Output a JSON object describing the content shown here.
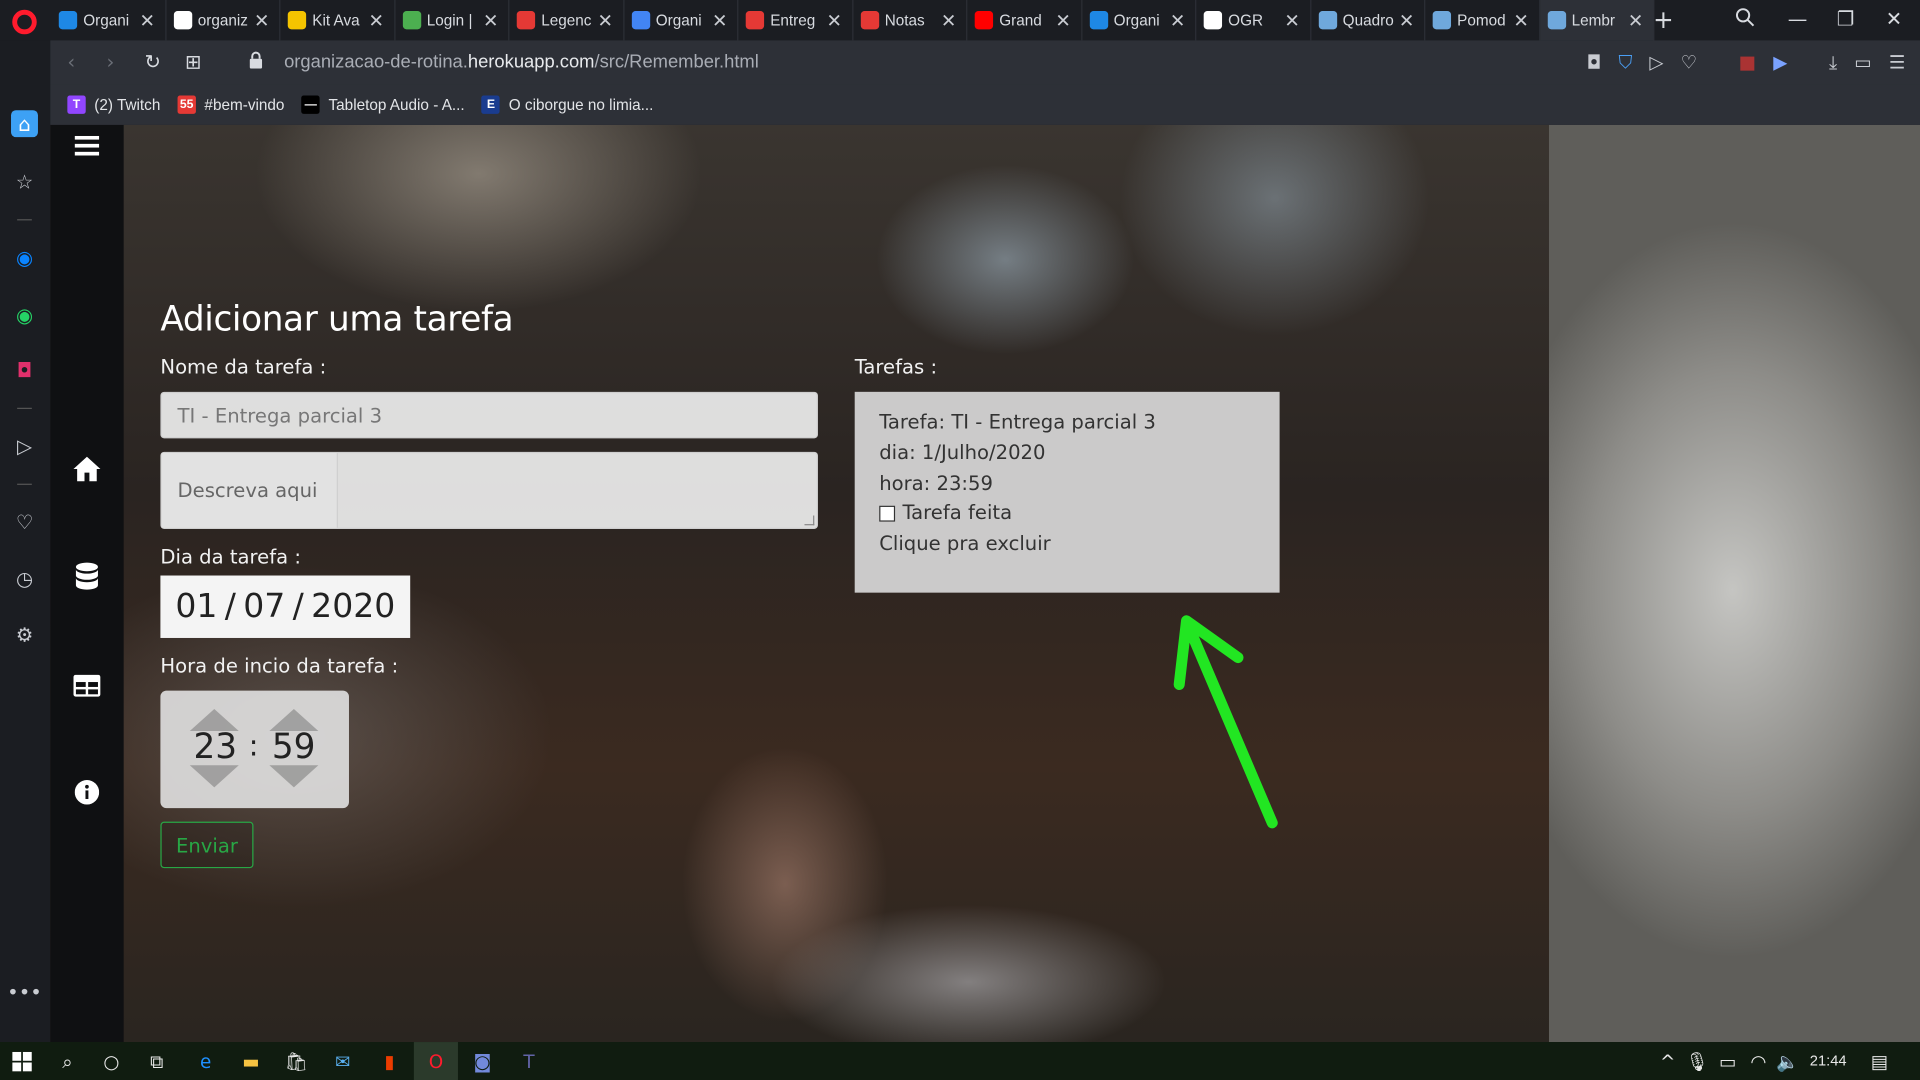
{
  "browser": {
    "tabs": [
      {
        "title": "Organi",
        "favicon_color": "#1e88e5"
      },
      {
        "title": "organiz",
        "favicon_color": "#ffffff"
      },
      {
        "title": "Kit Ava",
        "favicon_color": "#f5c400"
      },
      {
        "title": "Login |",
        "favicon_color": "#4caf50"
      },
      {
        "title": "Legenc",
        "favicon_color": "#e53935"
      },
      {
        "title": "Organi",
        "favicon_color": "#4285f4"
      },
      {
        "title": "Entreg",
        "favicon_color": "#e53935"
      },
      {
        "title": "Notas",
        "favicon_color": "#e53935"
      },
      {
        "title": "Grand",
        "favicon_color": "#ff0000"
      },
      {
        "title": "Organi",
        "favicon_color": "#1e88e5"
      },
      {
        "title": "OGR",
        "favicon_color": "#ffffff"
      },
      {
        "title": "Quadro",
        "favicon_color": "#6fa8dc"
      },
      {
        "title": "Pomod",
        "favicon_color": "#6fa8dc"
      },
      {
        "title": "Lembr",
        "favicon_color": "#6fa8dc",
        "active": true
      }
    ],
    "url_prefix": "organizacao-de-rotina.",
    "url_domain": "herokuapp.com",
    "url_path": "/src/Remember.html",
    "bookmarks": [
      {
        "label": "(2) Twitch",
        "color": "#9146ff",
        "glyph": "T"
      },
      {
        "label": "#bem-vindo",
        "color": "#e53935",
        "glyph": "55"
      },
      {
        "label": "Tabletop Audio - A...",
        "color": "#000000",
        "glyph": "—"
      },
      {
        "label": "O ciborgue no limia...",
        "color": "#1a3c8f",
        "glyph": "E"
      }
    ]
  },
  "page": {
    "title": "Adicionar uma tarefa",
    "task_name_label": "Nome da tarefa :",
    "task_name_value": "TI - Entrega parcial 3",
    "description_addon": "Descreva aqui",
    "date_label": "Dia da tarefa :",
    "date_day": "01",
    "date_month": "07",
    "date_year": "2020",
    "time_label": "Hora de incio da tarefa :",
    "time_hour": "23",
    "time_minute": "59",
    "time_sep": ":",
    "submit_label": "Enviar",
    "tasks_label": "Tarefas :",
    "task_card": {
      "task": "Tarefa: TI - Entrega parcial 3",
      "day": "dia: 1/Julho/2020",
      "hour": "hora: 23:59",
      "done_label": "Tarefa feita",
      "delete_label": "Clique pra excluir"
    }
  },
  "taskbar": {
    "clock": "21:44"
  },
  "colors": {
    "accent_green": "#28a745",
    "annotation_arrow": "#22e622"
  }
}
